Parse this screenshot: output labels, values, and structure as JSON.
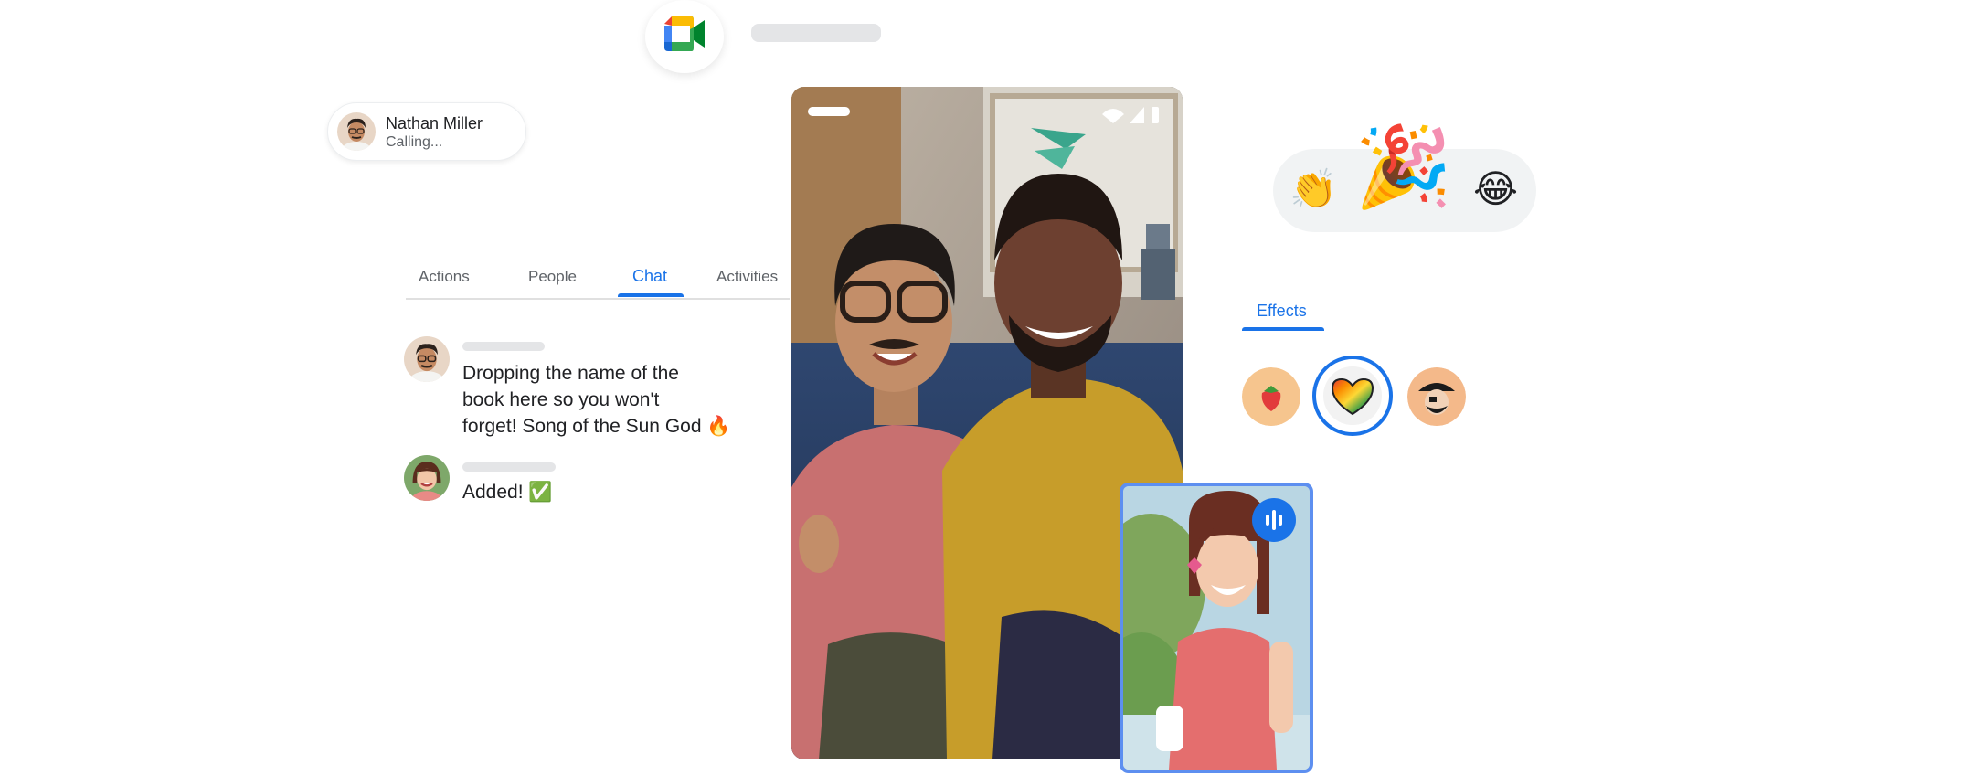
{
  "caller": {
    "name": "Nathan Miller",
    "status": "Calling..."
  },
  "tabs": [
    {
      "label": "Actions",
      "active": false
    },
    {
      "label": "People",
      "active": false
    },
    {
      "label": "Chat",
      "active": true
    },
    {
      "label": "Activities",
      "active": false
    }
  ],
  "chat": {
    "messages": [
      {
        "lines": [
          "Dropping the name of the",
          "book here so you won't",
          "forget! Song of the Sun God 🔥"
        ]
      },
      {
        "lines": [
          "Added! ✅"
        ]
      }
    ]
  },
  "reactions": {
    "items": [
      "👏",
      "🎉",
      "😂"
    ]
  },
  "effects": {
    "tab_label": "Effects",
    "items": [
      "strawberry",
      "heart",
      "pirate"
    ],
    "selected": "heart"
  },
  "colors": {
    "accent": "#1a73e8",
    "pip_border": "#5d8ff0",
    "pill_bg": "#f1f3f4"
  },
  "icons": {
    "logo": "google-meet-icon",
    "status_bar": [
      "wifi-icon",
      "signal-icon",
      "battery-icon"
    ],
    "speaking": "audio-waveform-icon"
  }
}
